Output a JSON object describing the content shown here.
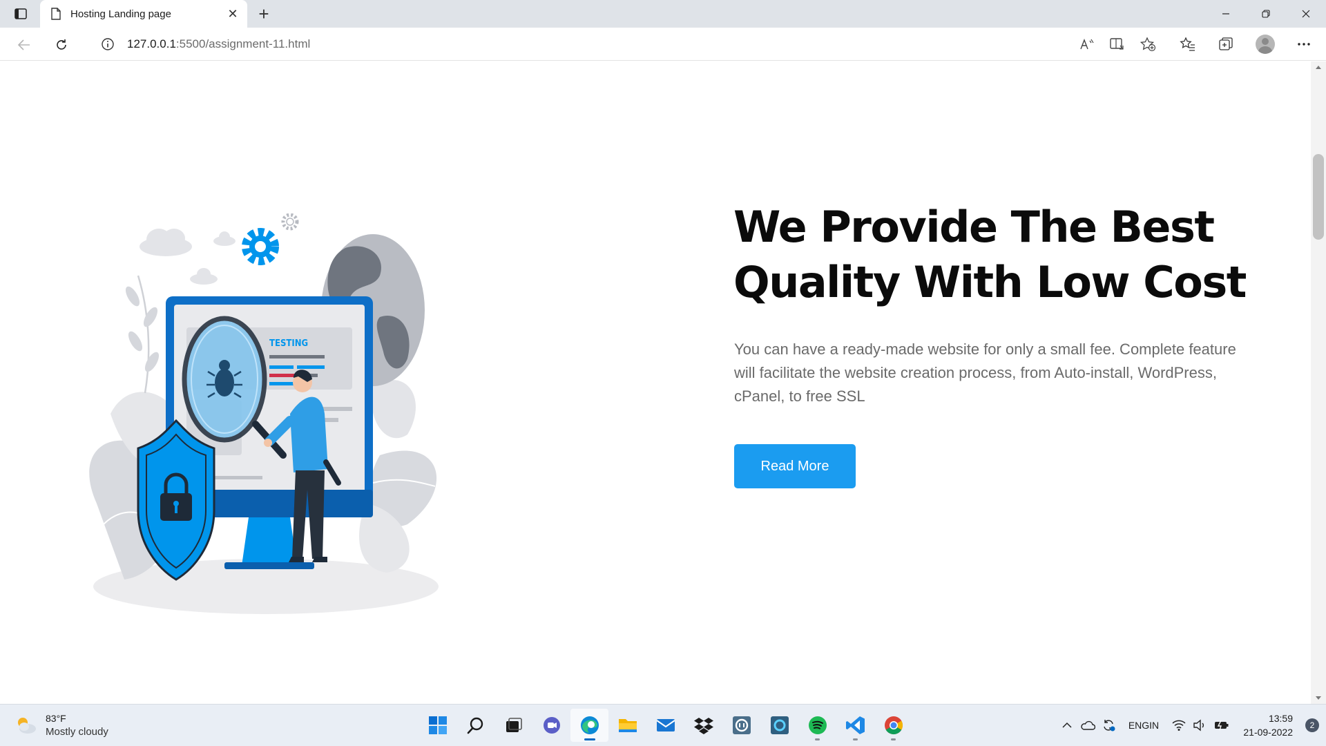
{
  "browser": {
    "tab_title": "Hosting Landing page",
    "tab_close": "✕",
    "new_tab": "+",
    "url_host": "127.0.0.1",
    "url_path": ":5500/assignment-11.html"
  },
  "page": {
    "headline_line1": "We Provide The Best",
    "headline_line2": "Quality With Low Cost",
    "description": "You can have a ready-made website for only a small fee. Complete feature will facilitate the website creation process, from Auto-install, WordPress, cPanel, to free SSL",
    "cta_label": "Read More",
    "illustration": {
      "badge_text": "TESTING"
    }
  },
  "taskbar": {
    "weather_temp": "83°F",
    "weather_desc": "Mostly cloudy",
    "lang_line1": "ENG",
    "lang_line2": "IN",
    "time": "13:59",
    "date": "21-09-2022",
    "notification_count": "2"
  },
  "colors": {
    "accent": "#1b9cf0",
    "illustration_blue": "#0095ec",
    "illustration_dark": "#1e2a38"
  }
}
